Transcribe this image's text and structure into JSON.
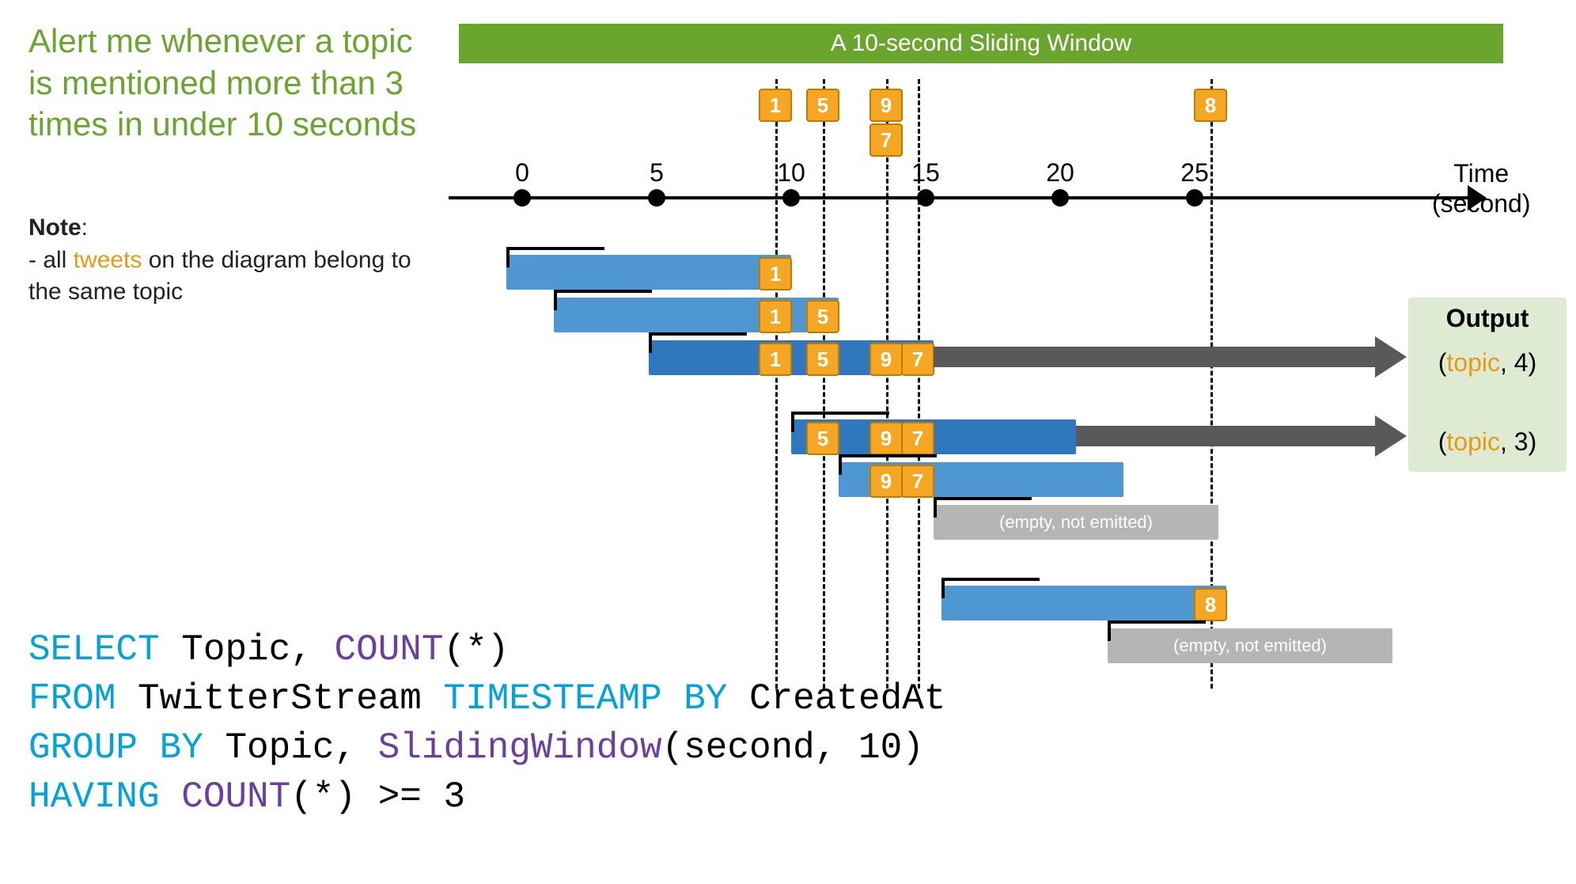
{
  "intro": "Alert me whenever a topic is mentioned more than 3 times in under 10 seconds",
  "note_bold": "Note",
  "note_text_prefix": "- all ",
  "note_tweets": "tweets",
  "note_text_suffix": " on the diagram belong to the same topic",
  "header": "A 10-second Sliding Window",
  "axis_label_top": "Time",
  "axis_label_bottom": "(second)",
  "ticks": [
    "0",
    "5",
    "10",
    "15",
    "20",
    "25"
  ],
  "events_top": {
    "a": "1",
    "b": "5",
    "c": "9",
    "d": "7",
    "e": "8"
  },
  "bars": {
    "b1": {
      "evts": [
        "1"
      ]
    },
    "b2": {
      "evts": [
        "1",
        "5"
      ]
    },
    "b3": {
      "evts": [
        "1",
        "5",
        "9",
        "7"
      ]
    },
    "b4": {
      "evts": [
        "5",
        "9",
        "7"
      ]
    },
    "b5": {
      "evts": [
        "9",
        "7"
      ]
    },
    "b6": {
      "empty": "(empty, not emitted)"
    },
    "b7": {
      "evts": [
        "8"
      ]
    },
    "b8": {
      "empty": "(empty, not emitted)"
    }
  },
  "output": {
    "title": "Output",
    "row1": {
      "topic": "topic",
      "count": "4"
    },
    "row2": {
      "topic": "topic",
      "count": "3"
    }
  },
  "sql": {
    "select": "SELECT",
    "topic": " Topic, ",
    "count": "COUNT",
    "star": "(*)",
    "from": "FROM",
    "stream": " TwitterStream ",
    "tsby": "TIMESTEAMP BY",
    "created": " CreatedAt",
    "groupby": "GROUP BY",
    "topic2": " Topic, ",
    "sw": "SlidingWindow",
    "swargs": "(second, 10)",
    "having": "HAVING",
    "count2": " COUNT",
    "tail": "(*) >= 3"
  },
  "geometry_note": "x positions for ticks 0..25 are 660,830,1000,1170,1340,1510 px; event lane x positions: 980(1),1040(5),1120(9),1160(7),1530(8)"
}
